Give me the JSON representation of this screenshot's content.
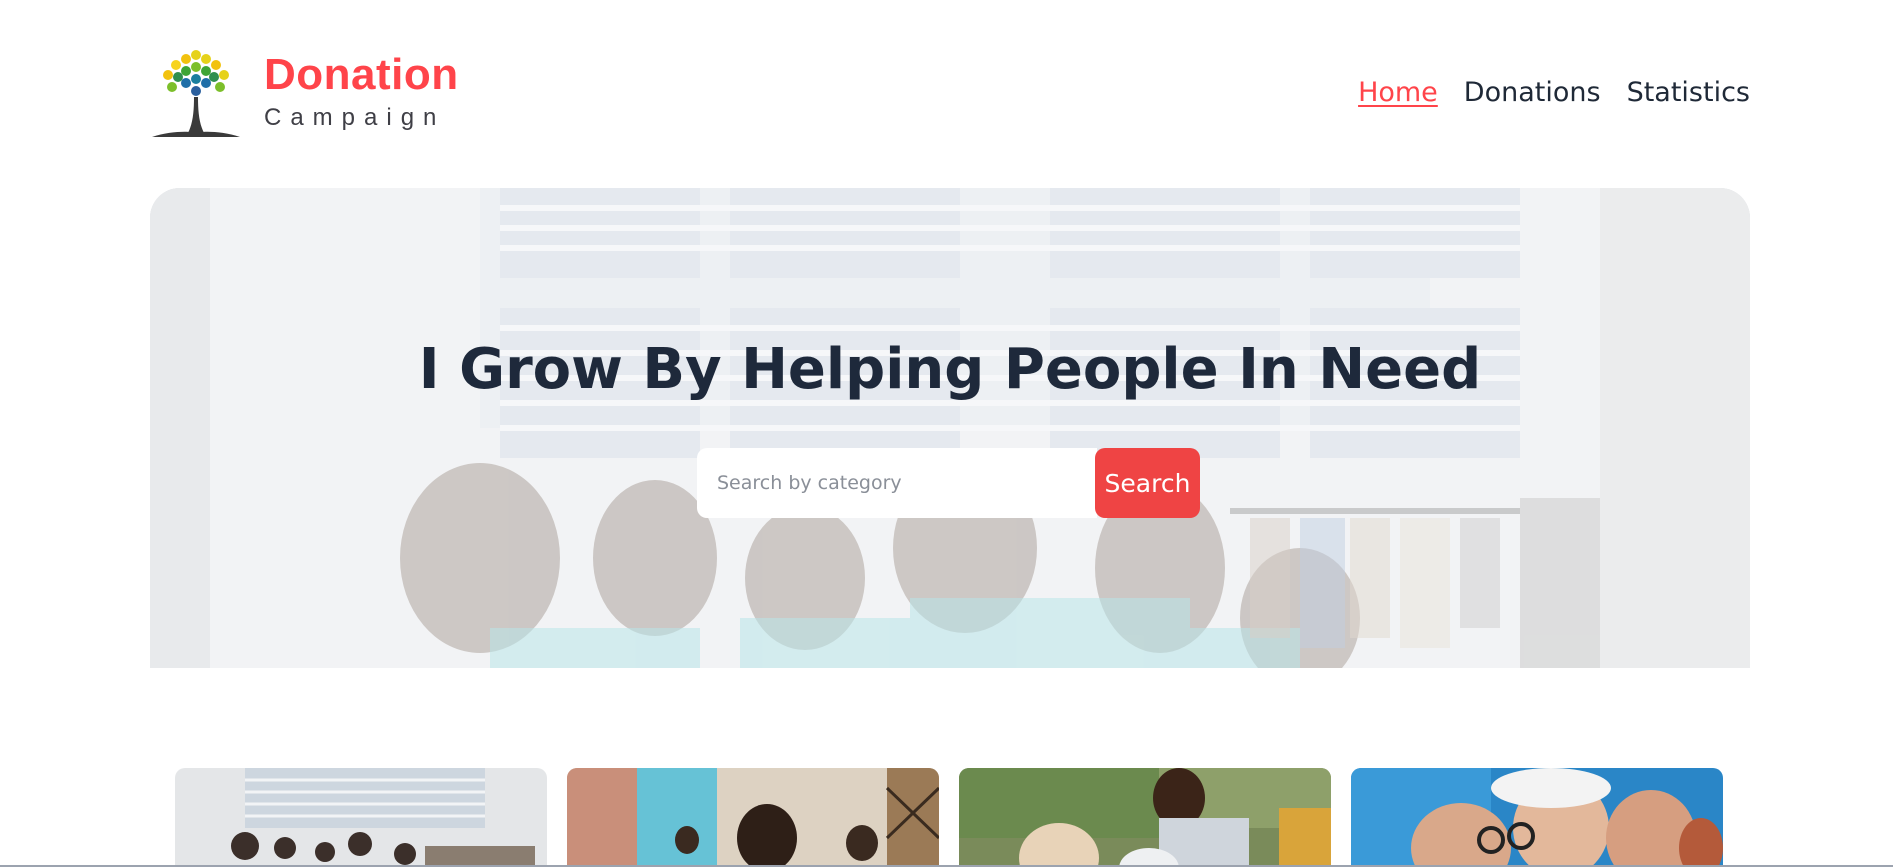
{
  "brand": {
    "title": "Donation",
    "subtitle": "Campaign",
    "accent_color": "#ff444a"
  },
  "nav": {
    "items": [
      {
        "label": "Home",
        "active": true
      },
      {
        "label": "Donations",
        "active": false
      },
      {
        "label": "Statistics",
        "active": false
      }
    ]
  },
  "hero": {
    "title": "I Grow By Helping People In Need",
    "search_placeholder": "Search by category",
    "search_button": "Search",
    "button_color": "#ef4444"
  },
  "cards": [
    {
      "image": "volunteers-sorting-clothes"
    },
    {
      "image": "child-education"
    },
    {
      "image": "food-distribution"
    },
    {
      "image": "group-huddle"
    }
  ]
}
